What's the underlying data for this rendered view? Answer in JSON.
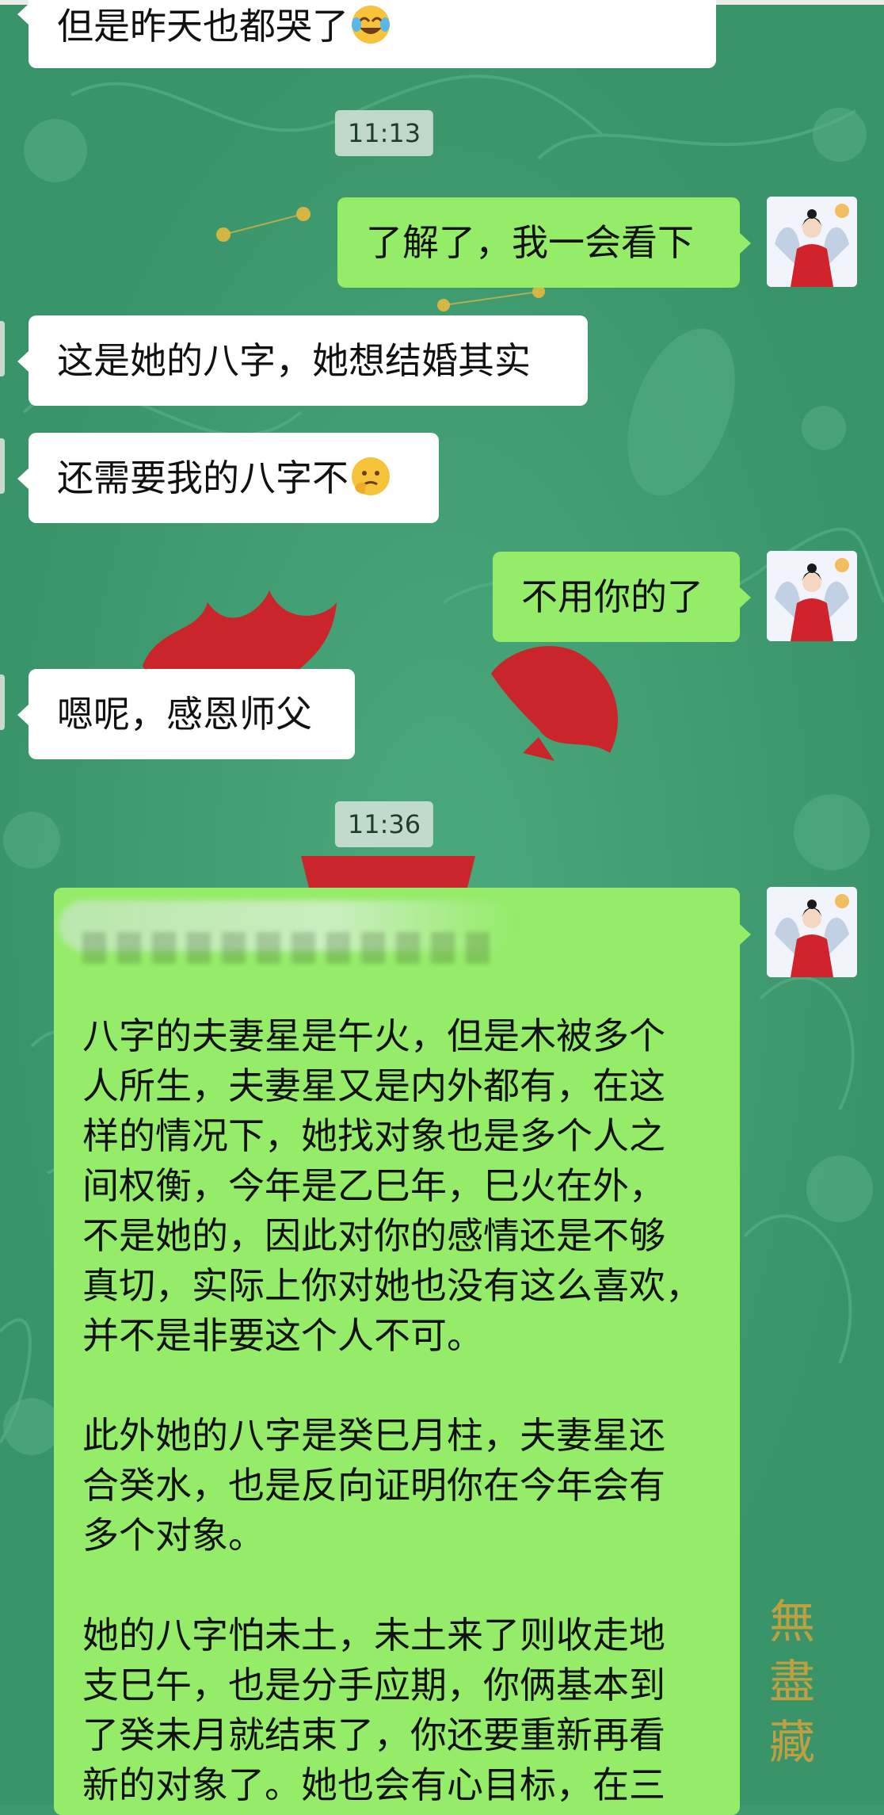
{
  "chat": {
    "messages_top": {
      "m1": "但是昨天也都哭了",
      "time1": "11:13",
      "m2": "了解了，我一会看下",
      "m3": "这是她的八字，她想结婚其实",
      "m4": "还需要我的八字不",
      "m5": "不用你的了",
      "m6": "嗯呢，感恩师父",
      "time2": "11:36"
    },
    "long_message": {
      "p1": "八字的夫妻星是午火，但是木被多个\n人所生，夫妻星又是内外都有，在这\n样的情况下，她找对象也是多个人之\n间权衡，今年是乙巳年，巳火在外，\n不是她的，因此对你的感情还是不够\n真切，实际上你对她也没有这么喜欢，\n并不是非要这个人不可。",
      "p2": "此外她的八字是癸巳月柱，夫妻星还\n合癸水，也是反向证明你在今年会有\n多个对象。",
      "p3": "她的八字怕未土，未土来了则收走地\n支巳午，也是分手应期，你俩基本到\n了癸未月就结束了，你还要重新再看\n新的对象了。她也会有心目标，在三"
    },
    "watermark": "無盡藏"
  },
  "icons": {
    "m1_emoji": "crying-laughing-emoji",
    "m4_emoji": "thinking-sad-emoji",
    "avatar": "avatar-woman-red-hanfu"
  },
  "colors": {
    "background": "#3d9a6e",
    "bubble_out": "#95ec69",
    "bubble_in": "#ffffff",
    "watermark": "#d8a23a"
  }
}
